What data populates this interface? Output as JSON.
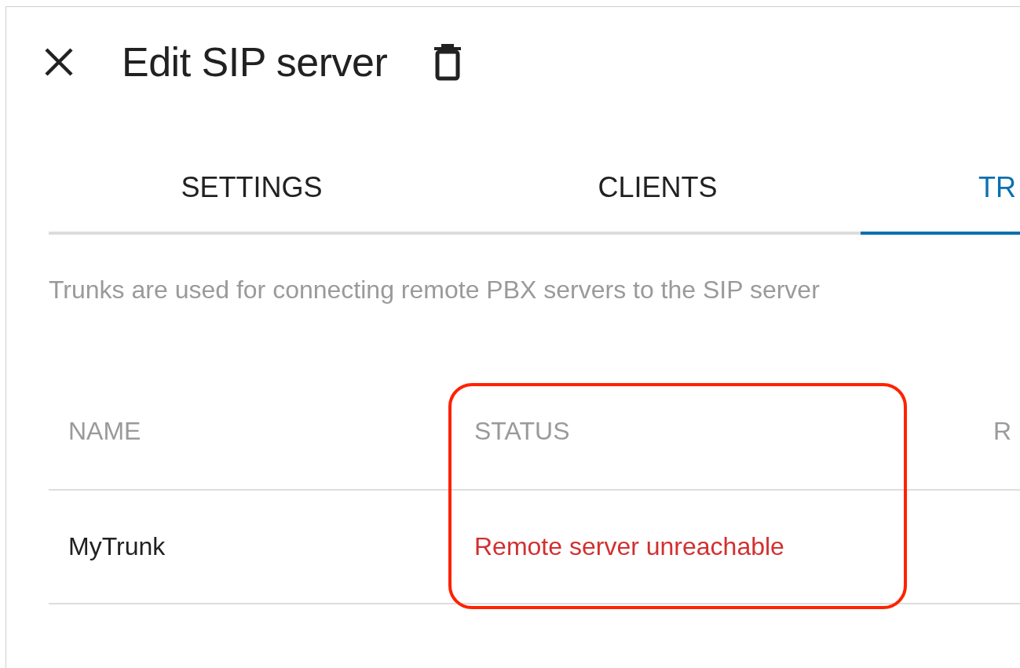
{
  "dialog": {
    "title": "Edit SIP server"
  },
  "tabs": [
    {
      "label": "SETTINGS",
      "selected": false
    },
    {
      "label": "CLIENTS",
      "selected": false
    },
    {
      "label": "TR",
      "selected": true
    }
  ],
  "description": "Trunks are used for connecting remote PBX servers to the SIP server",
  "table": {
    "columns": [
      {
        "label": "NAME",
        "highlighted": false
      },
      {
        "label": "STATUS",
        "highlighted": true
      },
      {
        "label": "R",
        "highlighted": false
      }
    ],
    "rows": [
      {
        "cells": [
          "MyTrunk",
          "Remote server unreachable",
          ""
        ],
        "kind": "error"
      }
    ]
  }
}
